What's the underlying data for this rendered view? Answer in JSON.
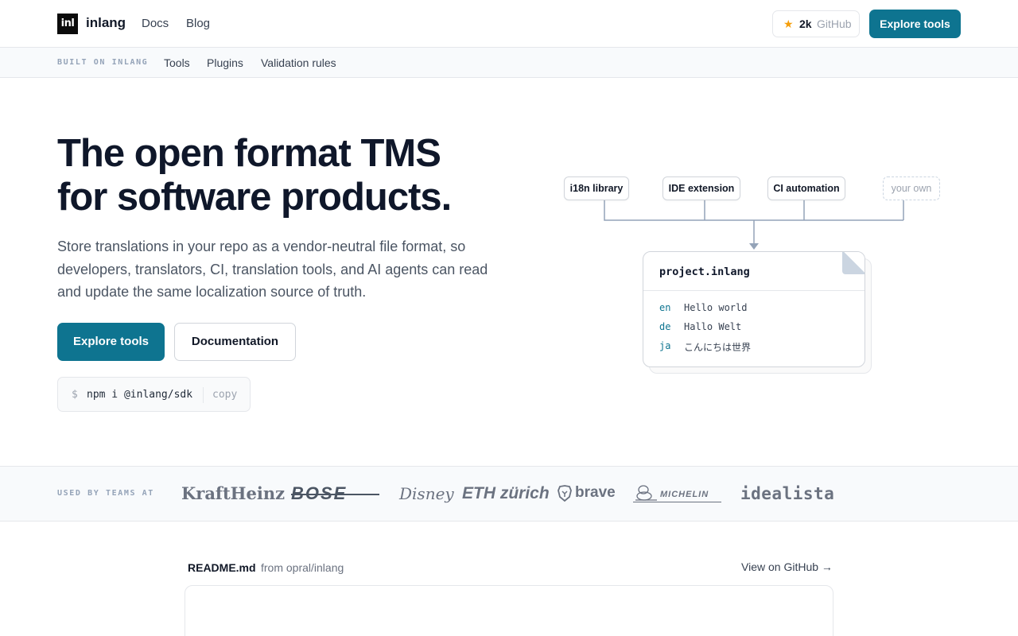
{
  "header": {
    "logo_mark": "inl",
    "logo_text": "inlang",
    "nav": [
      "Docs",
      "Blog"
    ],
    "github": {
      "count": "2k",
      "label": "GitHub"
    },
    "cta": "Explore tools"
  },
  "subnav": {
    "label": "BUILT ON INLANG",
    "links": [
      "Tools",
      "Plugins",
      "Validation rules"
    ]
  },
  "hero": {
    "title_line1": "The open format TMS",
    "title_line2": "for software products.",
    "description": "Store translations in your repo as a vendor-neutral file format, so developers, translators, CI, translation tools, and AI agents can read and update the same localization source of truth.",
    "primary_cta": "Explore tools",
    "secondary_cta": "Documentation",
    "npm": {
      "prompt": "$",
      "command": "npm i @inlang/sdk",
      "copy": "copy"
    }
  },
  "diagram": {
    "sources": [
      "i18n library",
      "IDE extension",
      "CI automation",
      "your own"
    ],
    "file": {
      "name": "project.inlang",
      "rows": [
        {
          "lang": "en",
          "text": "Hello world"
        },
        {
          "lang": "de",
          "text": "Hallo Welt"
        },
        {
          "lang": "ja",
          "text": "こんにちは世界"
        }
      ]
    }
  },
  "logos": {
    "label": "USED BY TEAMS AT",
    "companies": [
      "KraftHeinz",
      "BOSE",
      "Disney",
      "ETH zürich",
      "brave",
      "MICHELIN",
      "idealista"
    ]
  },
  "readme": {
    "file": "README.md",
    "from": "from opral/inlang",
    "link": "View on GitHub →"
  },
  "colors": {
    "accent": "#0e7490",
    "star": "#f59e0b"
  }
}
